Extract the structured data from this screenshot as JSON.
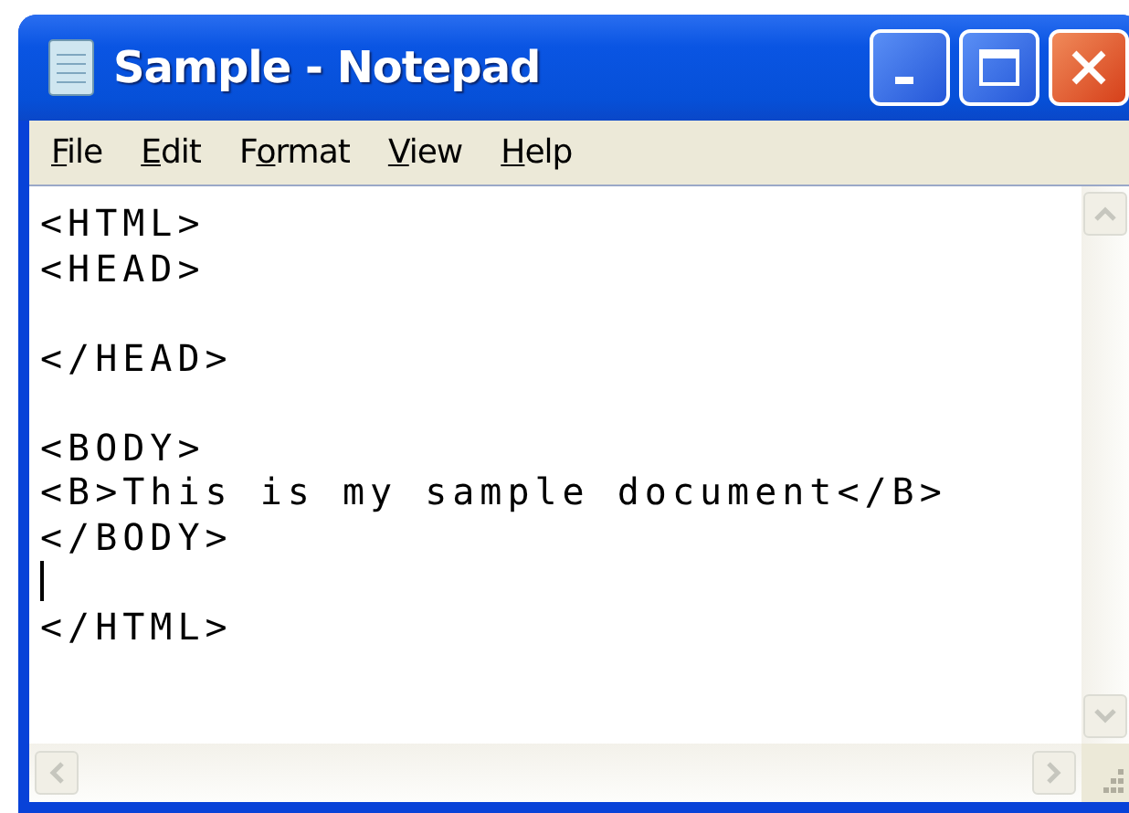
{
  "window": {
    "title": "Sample - Notepad"
  },
  "menu": [
    {
      "access_key": "F",
      "rest": "ile"
    },
    {
      "access_key": "E",
      "rest": "dit"
    },
    {
      "start": "F",
      "access_key": "o",
      "rest": "rmat"
    },
    {
      "access_key": "V",
      "rest": "iew"
    },
    {
      "access_key": "H",
      "rest": "elp"
    }
  ],
  "editor": {
    "text_before_caret": "<HTML>\n<HEAD>\n\n</HEAD>\n\n<BODY>\n<B>This is my sample document</B>\n</BODY>",
    "text_after_caret": "</HTML>"
  }
}
